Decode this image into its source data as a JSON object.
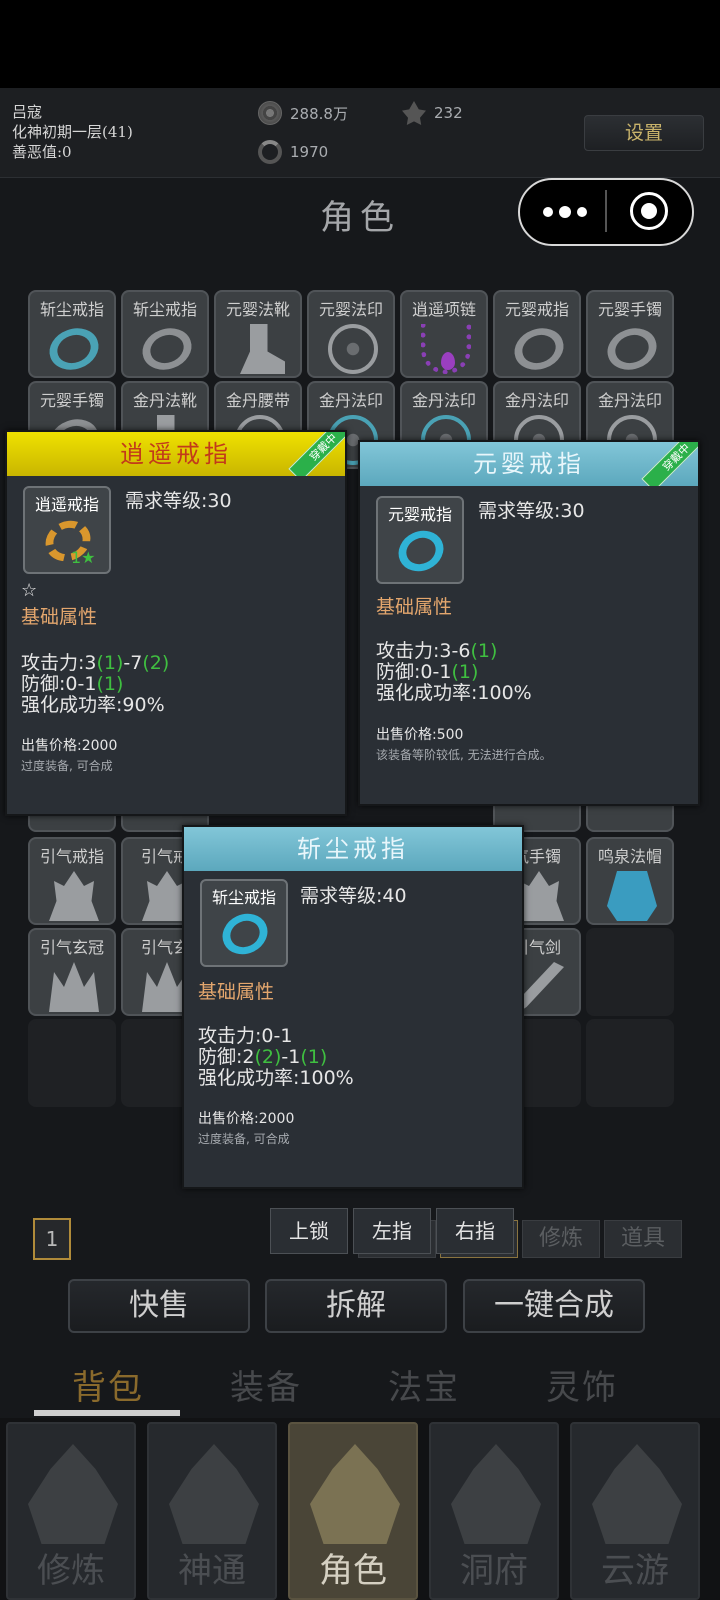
{
  "header": {
    "player_name": "吕寇",
    "realm": "化神初期一层(41)",
    "karma": "善恶值:0",
    "currency": "288.8万",
    "crystals": "232",
    "spirit": "1970",
    "settings_label": "设置"
  },
  "page_title": "角色",
  "grid": [
    {
      "label": "斩尘戒指",
      "icon": "ring-icon-cyan"
    },
    {
      "label": "斩尘戒指",
      "icon": "ring-icon"
    },
    {
      "label": "元婴法靴",
      "icon": "boot-icon"
    },
    {
      "label": "元婴法印",
      "icon": "seal-icon"
    },
    {
      "label": "逍遥项链",
      "icon": "necklace-icon"
    },
    {
      "label": "元婴戒指",
      "icon": "ring-icon"
    },
    {
      "label": "元婴手镯",
      "icon": "bracelet-icon"
    },
    {
      "label": "元婴手镯",
      "icon": "bracelet-icon"
    },
    {
      "label": "金丹法靴",
      "icon": "boot-icon"
    },
    {
      "label": "金丹腰带",
      "icon": "belt-icon"
    },
    {
      "label": "金丹法印",
      "icon": "seal-icon-cyan"
    },
    {
      "label": "金丹法印",
      "icon": "seal-icon-cyan"
    },
    {
      "label": "金丹法印",
      "icon": "seal-icon"
    },
    {
      "label": "金丹法印",
      "icon": "seal-icon"
    },
    {
      "label": "引气戒指",
      "icon": "flame-ring-icon"
    },
    {
      "label": "引气戒",
      "icon": "flame-ring-icon"
    },
    {
      "label": "气手镯",
      "icon": "flame-icon"
    },
    {
      "label": "鸣泉法帽",
      "icon": "hat-icon"
    },
    {
      "label": "引气玄冠",
      "icon": "crown-icon"
    },
    {
      "label": "引气玄",
      "icon": "crown-icon"
    },
    {
      "label": "引气剑",
      "icon": "sword-icon"
    }
  ],
  "tooltip_xiaoyao": {
    "title": "逍遥戒指",
    "badge": "穿戴中",
    "icon_label": "逍遥戒指",
    "icon_level": "1★",
    "req": "需求等级:30",
    "star": "☆",
    "base_attr": "基础属性",
    "atk_prefix": "攻击力:3",
    "atk_b1": "(1)",
    "atk_mid": "-7",
    "atk_b2": "(2)",
    "def_prefix": "防御:0-1",
    "def_b1": "(1)",
    "rate": "强化成功率:90%",
    "price": "出售价格:2000",
    "desc": "过度装备, 可合成"
  },
  "tooltip_yuanying": {
    "title": "元婴戒指",
    "badge": "穿戴中",
    "icon_label": "元婴戒指",
    "req": "需求等级:30",
    "base_attr": "基础属性",
    "atk_prefix": "攻击力:3-6",
    "atk_b1": "(1)",
    "def_prefix": "防御:0-1",
    "def_b1": "(1)",
    "rate": "强化成功率:100%",
    "price": "出售价格:500",
    "desc": "该装备等阶较低, 无法进行合成。"
  },
  "tooltip_zhanchen": {
    "title": "斩尘戒指",
    "icon_label": "斩尘戒指",
    "req": "需求等级:40",
    "base_attr": "基础属性",
    "atk": "攻击力:0-1",
    "def_prefix": "防御:2",
    "def_b1": "(2)",
    "def_mid": "-1",
    "def_b2": "(1)",
    "rate": "强化成功率:100%",
    "price": "出售价格:2000",
    "desc": "过度装备, 可合成"
  },
  "actions": {
    "lock": "上锁",
    "left": "左指",
    "right": "右指"
  },
  "page_number": "1",
  "filters": {
    "all": "全部",
    "equip": "装备",
    "refine": "修炼",
    "items": "道具"
  },
  "bottom_buttons": {
    "quick_sell": "快售",
    "dismantle": "拆解",
    "combine": "一键合成"
  },
  "bag_tabs": {
    "backpack": "背包",
    "equipment": "装备",
    "treasure": "法宝",
    "ornament": "灵饰"
  },
  "nav": {
    "cultivate": "修炼",
    "powers": "神通",
    "character": "角色",
    "cave": "洞府",
    "travel": "云游"
  },
  "colors": {
    "gold_header": "#e1d200",
    "cyan_header": "#6ab4c9",
    "green_bonus": "#3fbf40",
    "attr_orange": "#e3a66d"
  }
}
